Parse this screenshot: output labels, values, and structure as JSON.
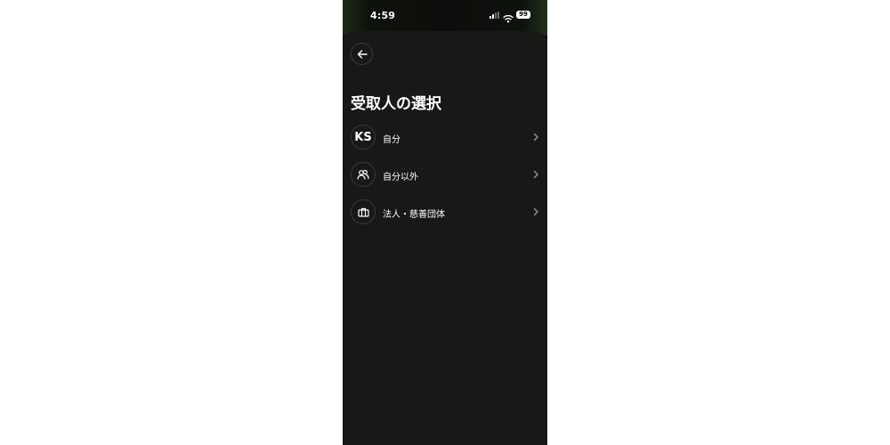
{
  "status_bar": {
    "time": "4:59",
    "battery": "99"
  },
  "header": {
    "title": "受取人の選択"
  },
  "options": [
    {
      "avatar_text": "KS",
      "label": "自分",
      "icon": "initials-avatar"
    },
    {
      "label": "自分以外",
      "icon": "people-icon"
    },
    {
      "label": "法人・慈善団体",
      "icon": "briefcase-icon"
    }
  ],
  "colors": {
    "background": "#181917",
    "text": "#ffffff",
    "border": "#3a3b39"
  }
}
